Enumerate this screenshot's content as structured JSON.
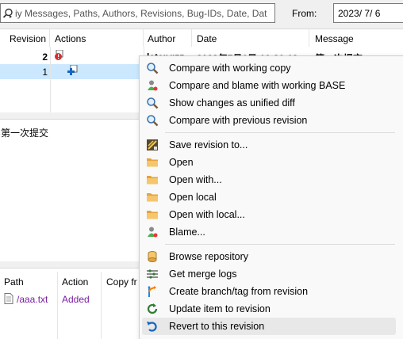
{
  "filter": {
    "search_placeholder": "iy Messages, Paths, Authors, Revisions, Bug-IDs, Date, Dat",
    "from_label": "From:",
    "from_date": "2023/  7/  6"
  },
  "log_table": {
    "headers": [
      "Revision",
      "Actions",
      "Author",
      "Date",
      "Message"
    ],
    "rows": [
      {
        "revision": "2",
        "author": "latengzz",
        "date": "2023年7月6日 16:26:13",
        "message": "第一次提交"
      },
      {
        "revision": "1",
        "author": "",
        "date": "",
        "message": ""
      }
    ]
  },
  "message_pane": {
    "text": "第一次提交"
  },
  "changed_paths": {
    "headers": [
      "Path",
      "Action",
      "Copy fr"
    ],
    "rows": [
      {
        "path": "/aaa.txt",
        "action": "Added"
      }
    ],
    "action_color": "#7b1fa2"
  },
  "context_menu": {
    "items": [
      {
        "label": "Compare with working copy",
        "icon": "magnifier-icon"
      },
      {
        "label": "Compare and blame with working BASE",
        "icon": "blame-person-icon"
      },
      {
        "label": "Show changes as unified diff",
        "icon": "magnifier-icon"
      },
      {
        "label": "Compare with previous revision",
        "icon": "magnifier-icon"
      },
      {
        "label": "Save revision to...",
        "icon": "save-icon"
      },
      {
        "label": "Open",
        "icon": "folder-icon"
      },
      {
        "label": "Open with...",
        "icon": "folder-icon"
      },
      {
        "label": "Open local",
        "icon": "folder-icon"
      },
      {
        "label": "Open with local...",
        "icon": "folder-icon"
      },
      {
        "label": "Blame...",
        "icon": "blame-person-icon"
      },
      {
        "label": "Browse repository",
        "icon": "repo-browser-icon"
      },
      {
        "label": "Get merge logs",
        "icon": "merge-logs-icon"
      },
      {
        "label": "Create branch/tag from revision",
        "icon": "branch-icon"
      },
      {
        "label": "Update item to revision",
        "icon": "update-icon"
      },
      {
        "label": "Revert to this revision",
        "icon": "revert-icon"
      }
    ],
    "hover_index": 14
  },
  "colors": {
    "selection": "#cce8ff",
    "menu_bg": "#f9f9f9",
    "menu_hover": "#e8e8e8"
  }
}
